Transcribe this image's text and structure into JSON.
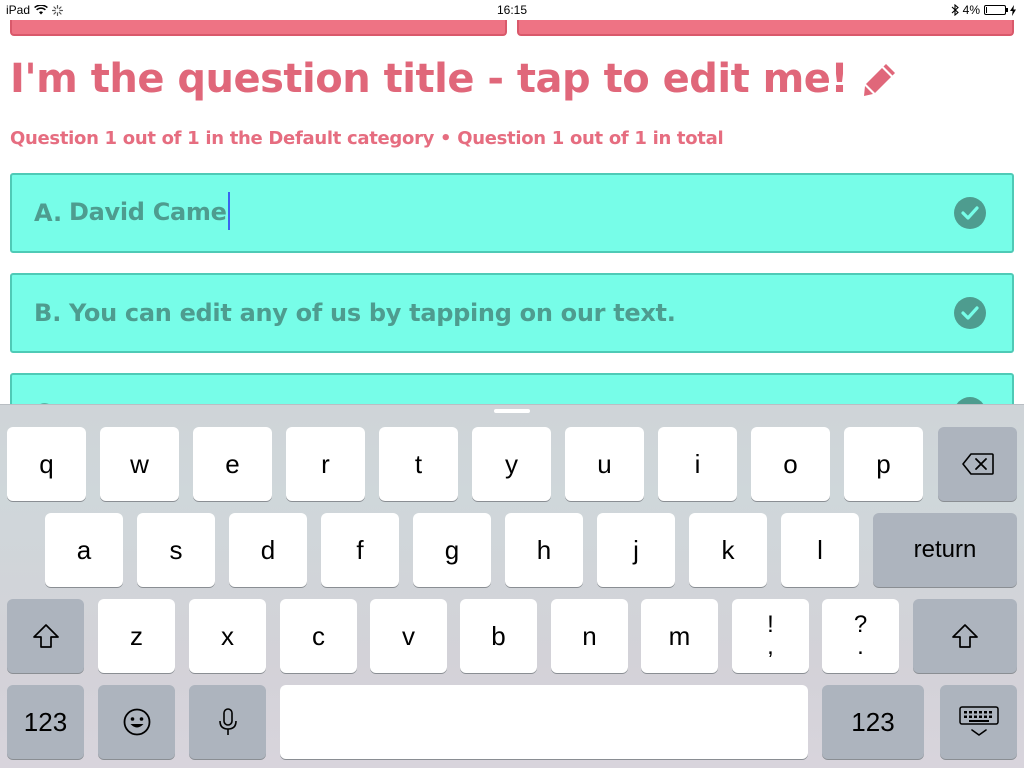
{
  "status_bar": {
    "device": "iPad",
    "time": "16:15",
    "battery": "4%",
    "battery_level": 0.04
  },
  "question": {
    "title": "I'm the question title - tap to edit me!",
    "subtitle": "Question 1 out of 1 in the Default category • Question 1 out of 1 in total"
  },
  "answers": [
    {
      "letter": "A.",
      "text": "David Came",
      "editing": true
    },
    {
      "letter": "B.",
      "text": "You can edit any of us by tapping on our text.",
      "editing": false
    },
    {
      "letter": "C.",
      "text": "",
      "editing": false
    }
  ],
  "keyboard": {
    "row1": [
      "q",
      "w",
      "e",
      "r",
      "t",
      "y",
      "u",
      "i",
      "o",
      "p"
    ],
    "row2": [
      "a",
      "s",
      "d",
      "f",
      "g",
      "h",
      "j",
      "k",
      "l"
    ],
    "row3": [
      "z",
      "x",
      "c",
      "v",
      "b",
      "n",
      "m"
    ],
    "punct1_top": "!",
    "punct1_bottom": ",",
    "punct2_top": "?",
    "punct2_bottom": ".",
    "return_label": "return",
    "numbers_label": "123",
    "icons": {
      "backspace": "delete-icon",
      "shift": "shift-icon",
      "emoji": "emoji-icon",
      "dictation": "microphone-icon",
      "dismiss": "keyboard-dismiss-icon"
    }
  },
  "colors": {
    "accent_pink": "#e0677a",
    "answer_bg": "#77fde8",
    "answer_text": "#4e9c8f",
    "caret": "#3a65f0"
  }
}
